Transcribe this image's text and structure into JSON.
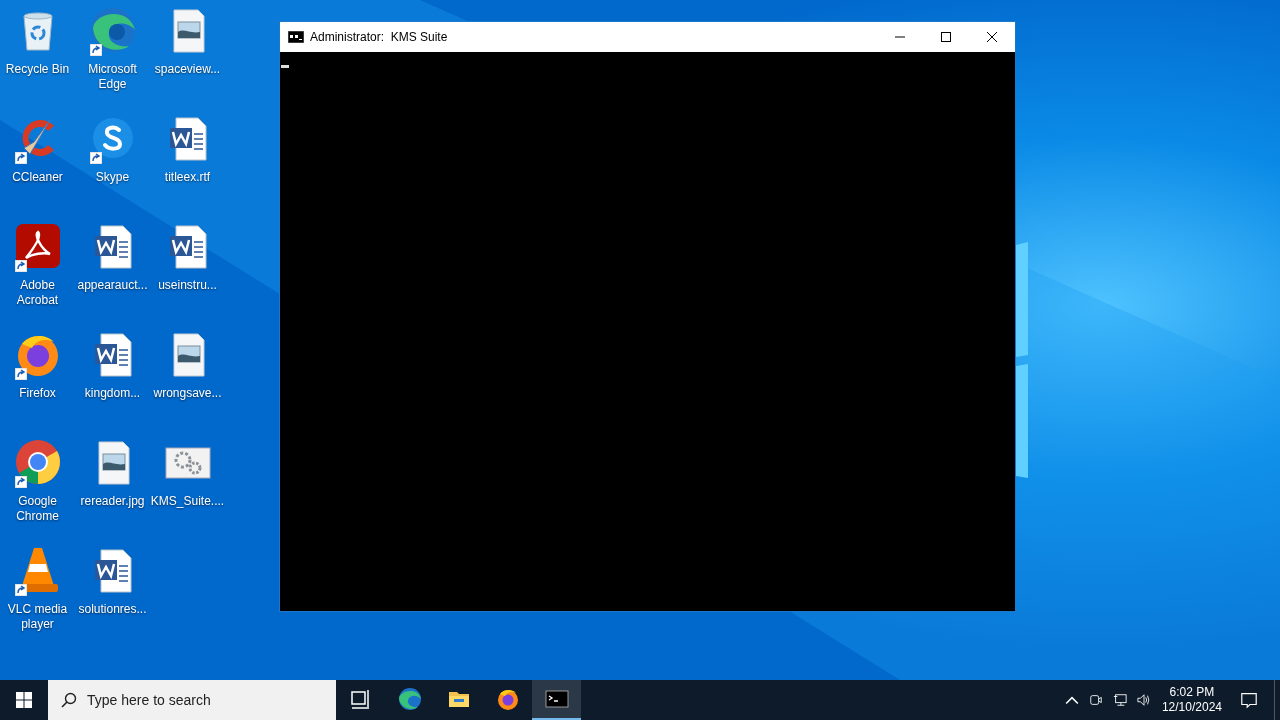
{
  "desktop_icons": [
    {
      "label": "Recycle Bin",
      "kind": "recycle",
      "shortcut": false
    },
    {
      "label": "CCleaner",
      "kind": "ccleaner",
      "shortcut": true
    },
    {
      "label": "Adobe Acrobat",
      "kind": "acrobat",
      "shortcut": true
    },
    {
      "label": "Firefox",
      "kind": "firefox",
      "shortcut": true
    },
    {
      "label": "Google Chrome",
      "kind": "chrome",
      "shortcut": true
    },
    {
      "label": "VLC media player",
      "kind": "vlc",
      "shortcut": true
    },
    {
      "label": "Microsoft Edge",
      "kind": "edge",
      "shortcut": true
    },
    {
      "label": "Skype",
      "kind": "skype",
      "shortcut": true
    },
    {
      "label": "appearauct...",
      "kind": "word",
      "shortcut": false
    },
    {
      "label": "kingdom...",
      "kind": "word",
      "shortcut": false
    },
    {
      "label": "rereader.jpg",
      "kind": "image",
      "shortcut": false
    },
    {
      "label": "solutionres...",
      "kind": "word",
      "shortcut": false
    },
    {
      "label": "spaceview...",
      "kind": "image",
      "shortcut": false
    },
    {
      "label": "titleex.rtf",
      "kind": "word",
      "shortcut": false
    },
    {
      "label": "useinstru...",
      "kind": "word",
      "shortcut": false
    },
    {
      "label": "wrongsave...",
      "kind": "image",
      "shortcut": false
    },
    {
      "label": "KMS_Suite....",
      "kind": "app",
      "shortcut": false
    }
  ],
  "window": {
    "title": "Administrator:  KMS Suite"
  },
  "taskbar": {
    "search": {
      "placeholder": "Type here to search"
    },
    "apps": [
      {
        "kind": "taskview",
        "selected": false
      },
      {
        "kind": "edge",
        "selected": false
      },
      {
        "kind": "explorer",
        "selected": false
      },
      {
        "kind": "firefox",
        "selected": false
      },
      {
        "kind": "console",
        "selected": true
      }
    ],
    "clock": {
      "time": "6:02 PM",
      "date": "12/10/2024"
    }
  }
}
